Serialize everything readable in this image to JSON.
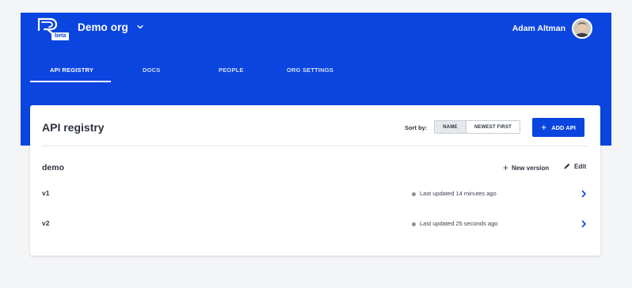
{
  "header": {
    "logo_badge": "beta",
    "org_name": "Demo org",
    "user_name": "Adam Altman"
  },
  "tabs": [
    {
      "label": "API REGISTRY",
      "active": true
    },
    {
      "label": "DOCS",
      "active": false
    },
    {
      "label": "PEOPLE",
      "active": false
    },
    {
      "label": "ORG SETTINGS",
      "active": false
    }
  ],
  "registry": {
    "title": "API registry",
    "sort_label": "Sort by:",
    "sort_options": [
      {
        "label": "NAME",
        "selected": true
      },
      {
        "label": "NEWEST FIRST",
        "selected": false
      }
    ],
    "add_button": "ADD API",
    "groups": [
      {
        "name": "demo",
        "new_version_label": "New version",
        "edit_label": "Edit",
        "versions": [
          {
            "label": "v1",
            "updated": "Last updated 14 minutes ago"
          },
          {
            "label": "v2",
            "updated": "Last updated 25 seconds ago"
          }
        ]
      }
    ]
  },
  "colors": {
    "brand": "#0b45e0",
    "background": "#f4f5f7",
    "text": "#2e3340"
  },
  "icons": [
    "logo-icon",
    "chevron-down-icon",
    "plus-icon",
    "pencil-icon",
    "chevron-right-icon"
  ]
}
